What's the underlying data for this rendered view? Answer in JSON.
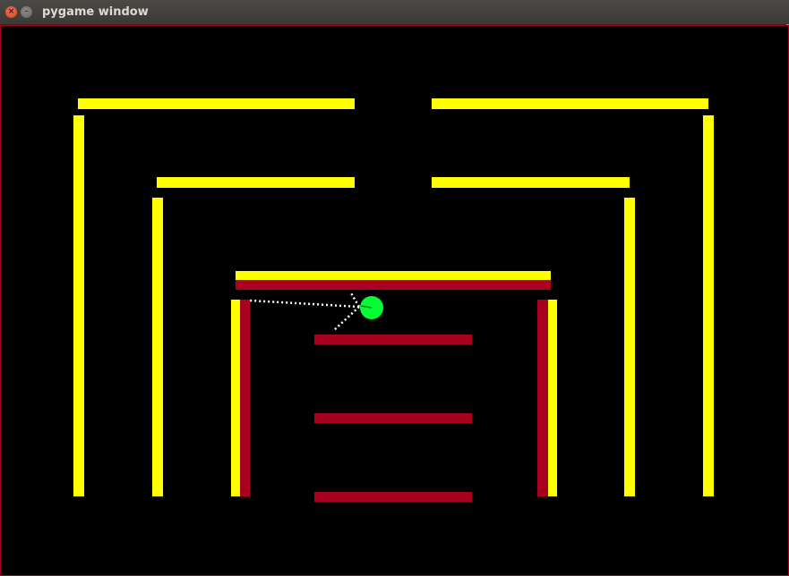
{
  "window": {
    "title": "pygame window",
    "close_glyph": "×",
    "minimize_glyph": "–"
  },
  "colors": {
    "background": "#000000",
    "outer_wall": "#ffff00",
    "inner_wall": "#aa0020",
    "agent": "#00ff33",
    "sensor": "#ffffff",
    "border": "#a8001c"
  },
  "agent": {
    "shape": "circle",
    "color_name": "green"
  },
  "sensors": {
    "style": "dotted",
    "count": 3
  }
}
